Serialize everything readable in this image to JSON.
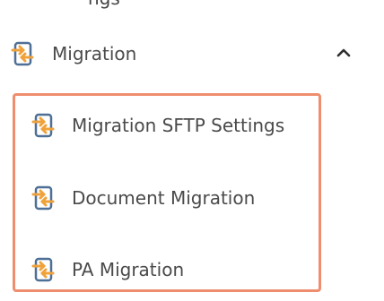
{
  "top_crop_text": "ngs",
  "menu": {
    "title": "Migration",
    "expanded": true,
    "items": [
      {
        "label": "Migration SFTP Settings"
      },
      {
        "label": "Document Migration"
      },
      {
        "label": "PA Migration"
      }
    ]
  },
  "colors": {
    "icon_orange": "#f0a23a",
    "icon_blue": "#4e6f96",
    "highlight_border": "#ef8e6e",
    "text": "#4a4a4a"
  },
  "icons": {
    "migration": "migration-icon",
    "chevron": "chevron-up-icon"
  }
}
